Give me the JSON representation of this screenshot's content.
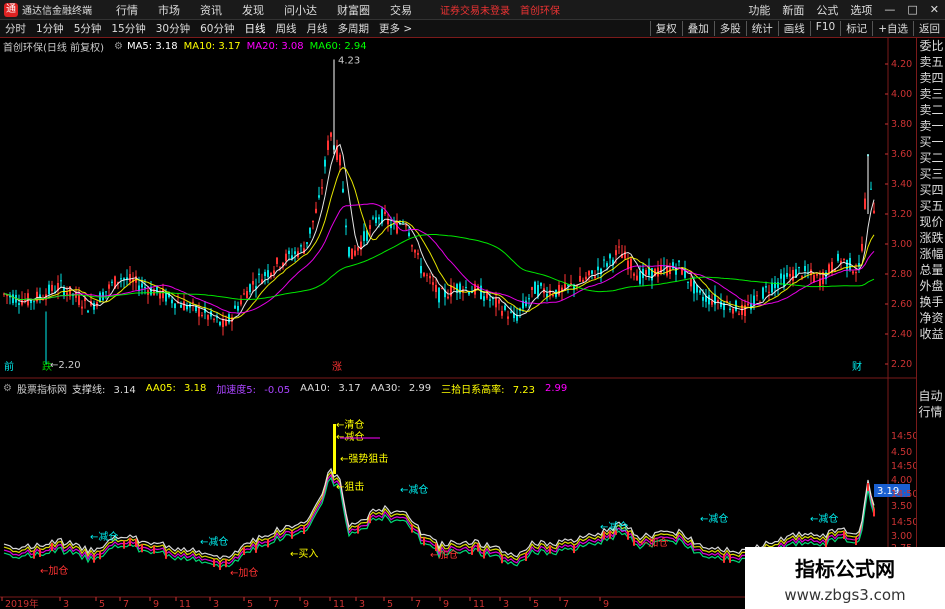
{
  "app": {
    "title": "通达信金融终端",
    "menu": [
      "行情",
      "市场",
      "资讯",
      "发现",
      "问小达",
      "财富圈",
      "交易"
    ],
    "warning": "证券交易未登录",
    "stock": "首创环保",
    "right_menu": [
      "功能",
      "新面",
      "公式",
      "选项"
    ]
  },
  "toolbar": {
    "periods": [
      "分时",
      "1分钟",
      "5分钟",
      "15分钟",
      "30分钟",
      "60分钟",
      "日线",
      "周线",
      "月线",
      "多周期",
      "更多 >"
    ],
    "right": [
      "复权",
      "叠加",
      "多股",
      "统计",
      "画线",
      "F10",
      "标记",
      "+自选",
      "返回"
    ]
  },
  "main_chart": {
    "name": "首创环保(日线 前复权)",
    "ma5_label": "MA5:",
    "ma5": "3.18",
    "ma10_label": "MA10:",
    "ma10": "3.17",
    "ma20_label": "MA20:",
    "ma20": "3.08",
    "ma60_label": "MA60:",
    "ma60": "2.94",
    "high_label": "4.23",
    "low_label": "2.20"
  },
  "sub_chart": {
    "name": "股票指标网",
    "zc_label": "支撑线:",
    "zc": "3.14",
    "aa05_label": "AA05:",
    "aa05": "3.18",
    "jsd_label": "加速度5:",
    "jsd": "-0.05",
    "aa10_label": "AA10:",
    "aa10": "3.17",
    "aa30_label": "AA30:",
    "aa30": "2.99",
    "ssrz_label": "三拾日系高率:",
    "ssrz": "7.23",
    "last": "2.99",
    "current_tag": "3.19"
  },
  "right_panel": [
    "委比",
    "卖五",
    "卖四",
    "卖三",
    "卖二",
    "卖一",
    "买一",
    "买二",
    "买三",
    "买四",
    "买五",
    "现价",
    "涨跌",
    "涨幅",
    "总量",
    "外盘",
    "换手",
    "净资",
    "收益"
  ],
  "right_panel2": [
    "自动",
    "行情"
  ],
  "y_axis_main": [
    "4.20",
    "4.00",
    "3.80",
    "3.60",
    "3.40",
    "3.20",
    "3.00",
    "2.80",
    "2.60",
    "2.40",
    "2.20"
  ],
  "y_axis_sub": [
    "14:50",
    "4.50",
    "14:50",
    "4.00",
    "14:50",
    "3.50",
    "14:50",
    "3.00",
    "2.75"
  ],
  "x_axis": [
    "2019年",
    "3",
    "5",
    "7",
    "9",
    "11",
    "3",
    "5",
    "7",
    "9",
    "11",
    "3",
    "5",
    "7",
    "9",
    "11",
    "3",
    "5",
    "7",
    "9"
  ],
  "annotations": [
    "清仓",
    "减仓",
    "强势狙击",
    "狙击",
    "减仓",
    "加仓",
    "买入"
  ],
  "markers": [
    "前",
    "跌",
    "涨",
    "财"
  ],
  "watermark": {
    "line1": "指标公式网",
    "line2": "www.zbgs3.com"
  },
  "colors": {
    "up": "#ff3333",
    "down": "#00e0e0",
    "ma5": "#ffffff",
    "ma10": "#ffff00",
    "ma20": "#ff00ff",
    "ma60": "#00ff00",
    "axis": "#c33"
  }
}
